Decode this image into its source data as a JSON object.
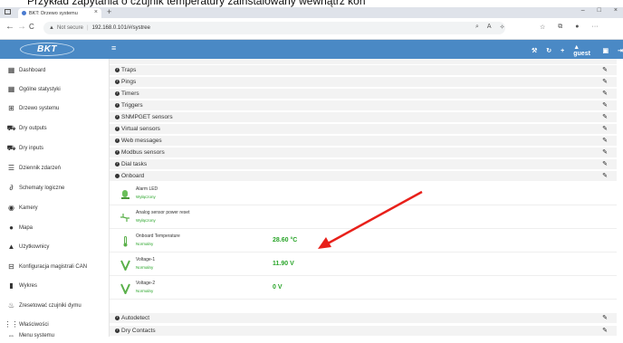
{
  "caption": "Przykład zapytania o czujnik temperatury zainstalowany wewnątrz kon",
  "browser": {
    "tab_title": "BKT: Drzewo systemu",
    "tab_close": "×",
    "new_tab": "+",
    "win_min": "–",
    "win_max": "□",
    "win_close": "×",
    "back": "←",
    "forward": "→",
    "reload": "C",
    "not_secure": "Not secure",
    "url": "192.168.0.101/#/systree",
    "more": "···"
  },
  "header": {
    "logo": "BKT",
    "menu_glyph": "≡",
    "user": "guest"
  },
  "sidebar": {
    "items": [
      {
        "label": "Dashboard",
        "icon": "dashboard-icon"
      },
      {
        "label": "Ogólne statystyki",
        "icon": "stats-icon"
      },
      {
        "label": "Drzewo systemu",
        "icon": "tree-icon"
      },
      {
        "label": "Dry outputs",
        "icon": "car-icon"
      },
      {
        "label": "Dry inputs",
        "icon": "car-icon"
      },
      {
        "label": "Dziennik zdarzeń",
        "icon": "list-icon"
      },
      {
        "label": "Schematy logiczne",
        "icon": "link-icon"
      },
      {
        "label": "Kamery",
        "icon": "camera-icon"
      },
      {
        "label": "Mapa",
        "icon": "map-pin-icon"
      },
      {
        "label": "Użytkownicy",
        "icon": "user-icon"
      },
      {
        "label": "Konfiguracja magistrali CAN",
        "icon": "can-icon"
      },
      {
        "label": "Wykres",
        "icon": "chart-icon"
      },
      {
        "label": "Zresetować czujniki dymu",
        "icon": "fire-icon"
      },
      {
        "label": "Właściwości",
        "icon": "properties-icon"
      },
      {
        "label": "Menu systemu",
        "icon": "menu-icon"
      }
    ]
  },
  "tree": {
    "rows_top": [
      "Traps",
      "Pings",
      "Timers",
      "Triggers",
      "SNMPGET sensors",
      "Virtual sensors",
      "Web messages",
      "Modbus sensors",
      "Dial tasks",
      "Onboard"
    ],
    "onboard": [
      {
        "name": "Alarm LED",
        "status": "Wyłączony",
        "value": "",
        "icon": "led-icon"
      },
      {
        "name": "Analog sensor power reset",
        "status": "Wyłączony",
        "value": "",
        "icon": "power-reset-icon"
      },
      {
        "name": "Onboard Temperature",
        "status": "Normalny",
        "value": "28.60 °C",
        "icon": "thermometer-icon"
      },
      {
        "name": "Voltage-1",
        "status": "Normalny",
        "value": "11.90 V",
        "icon": "voltage-icon"
      },
      {
        "name": "Voltage-2",
        "status": "Normalny",
        "value": "0 V",
        "icon": "voltage-icon"
      }
    ],
    "rows_bottom": [
      "Autodetect",
      "Dry Contacts"
    ]
  },
  "colors": {
    "header": "#4a89c5",
    "ok_green": "#2aa52a",
    "arrow": "#e8201a"
  }
}
